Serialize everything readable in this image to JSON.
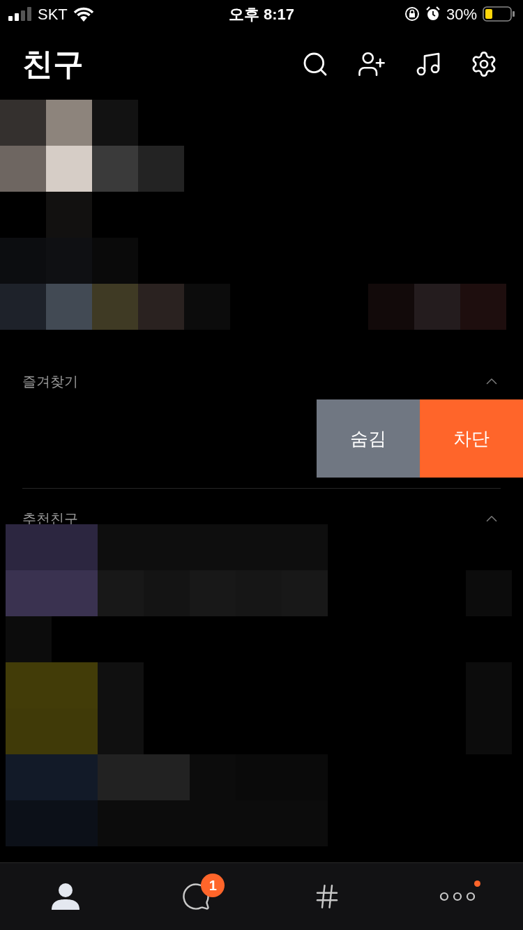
{
  "status_bar": {
    "carrier": "SKT",
    "time": "오후 8:17",
    "battery": "30%"
  },
  "header": {
    "title": "친구"
  },
  "sections": [
    {
      "title": "즐겨찾기",
      "expanded": true
    },
    {
      "title": "추천친구",
      "expanded": true
    }
  ],
  "swipe_actions": [
    {
      "label": "숨김",
      "kind": "hide"
    },
    {
      "label": "차단",
      "kind": "block"
    }
  ],
  "tabs": [
    {
      "kind": "friends",
      "selected": true
    },
    {
      "kind": "chats",
      "selected": false,
      "badge": "1"
    },
    {
      "kind": "hashtag",
      "selected": false
    },
    {
      "kind": "more",
      "selected": false,
      "dot": true
    }
  ]
}
